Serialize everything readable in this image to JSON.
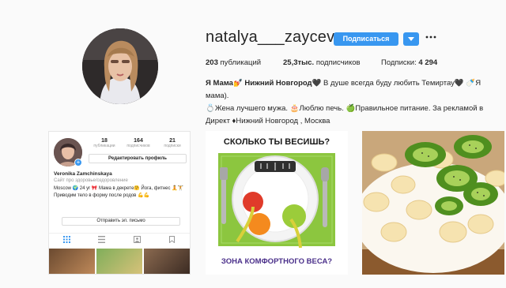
{
  "profile": {
    "username": "natalya___zayceva",
    "follow_label": "Подписаться",
    "more_icon": "ellipsis-icon",
    "stats": {
      "posts_count": "203",
      "posts_label": "публикаций",
      "followers_count": "25,3тыс.",
      "followers_label": "подписчиков",
      "following_label": "Подписки:",
      "following_count": "4 294"
    },
    "bio_line1_bold": "Я Мама💅 Нижний Новгород🖤",
    "bio_line1_rest": " В душе всегда буду любить Темиртау🖤 🍼Я мама).",
    "bio_line2": "💍Жена лучшего мужа. 🎂Люблю печь. 🍏Правильное питание. За рекламой в",
    "bio_line3": "Директ ♦Нижний Новгород , Москва",
    "colors": {
      "accent": "#3897f0"
    }
  },
  "posts": {
    "mini_profile": {
      "stats": [
        {
          "n": "18",
          "l": "публикации"
        },
        {
          "n": "164",
          "l": "подписчиков"
        },
        {
          "n": "21",
          "l": "подписки"
        }
      ],
      "edit_label": "Редактировать профиль",
      "name": "Veronika Zamchinskaya",
      "category": "Сайт про здоровье/оздоровление",
      "bio": "Moscow 🌍 24 yr 🎀 Мама в декрете🤗 Йога, фитнес 🧘🏋 Приводим тело в форму после родов 💪💪",
      "email_label": "Отправить эл. письмо"
    },
    "weight_post": {
      "title": "СКОЛЬКО ТЫ ВЕСИШЬ?",
      "bottom": "ЗОНА КОМФОРТНОГО ВЕСА?"
    }
  }
}
